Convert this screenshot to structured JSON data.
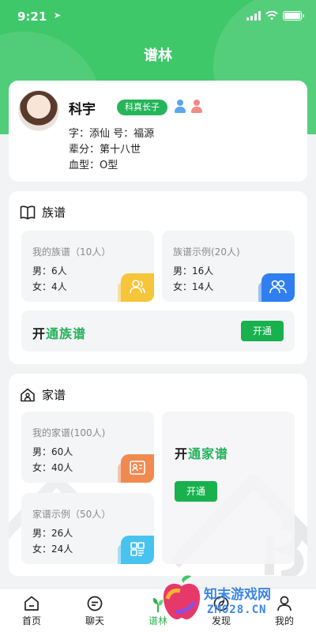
{
  "status": {
    "time": "9:21"
  },
  "nav": {
    "title": "谱林"
  },
  "profile": {
    "name": "科宇",
    "tag": "科真长子",
    "zi_hao": "字：添仙  号：福源",
    "generation": "辈分：第十八世",
    "blood": "血型：O型"
  },
  "zupu": {
    "title": "族谱",
    "my": {
      "title": "我的族谱（10人）",
      "male": "男：6人",
      "female": "女：4人"
    },
    "example": {
      "title": "族谱示例(20人)",
      "male": "男：16人",
      "female": "女：14人"
    },
    "banner": {
      "prefix": "开",
      "brand": "通族谱",
      "button": "开通"
    }
  },
  "jiapu": {
    "title": "家谱",
    "my": {
      "title": "我的家谱(100人)",
      "male": "男：60人",
      "female": "女：40人"
    },
    "example": {
      "title": "家谱示例（50人）",
      "male": "男：26人",
      "female": "女：24人"
    },
    "banner": {
      "prefix": "开",
      "brand": "通家谱",
      "button": "开通"
    }
  },
  "tabs": [
    {
      "label": "首页",
      "icon": "home-icon"
    },
    {
      "label": "聊天",
      "icon": "chat-icon"
    },
    {
      "label": "谱林",
      "icon": "tree-icon",
      "active": true
    },
    {
      "label": "发现",
      "icon": "compass-icon"
    },
    {
      "label": "我的",
      "icon": "person-icon"
    }
  ],
  "watermark": {
    "line1": "知末游戏网",
    "line2": "ZMO28.CN"
  },
  "colors": {
    "primary": "#3ec86a",
    "button": "#18b14e",
    "yellow_badge": "#f7c53a",
    "blue_badge": "#2f7ff0",
    "orange_badge": "#f08a50",
    "cyan_badge": "#48c3f0"
  }
}
